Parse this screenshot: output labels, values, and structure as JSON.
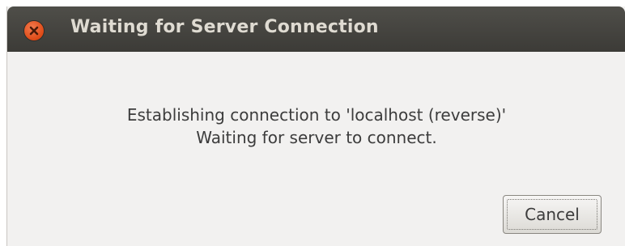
{
  "window": {
    "title": "Waiting for Server Connection",
    "close_icon": "close-icon"
  },
  "message": {
    "line1": "Establishing connection to 'localhost (reverse)'",
    "line2": "Waiting for server to connect."
  },
  "buttons": {
    "cancel_label": "Cancel"
  },
  "colors": {
    "titlebar": "#3c3b37",
    "title_text": "#dfdbd2",
    "close_button": "#df4a16",
    "dialog_background": "#f2f1f0"
  }
}
